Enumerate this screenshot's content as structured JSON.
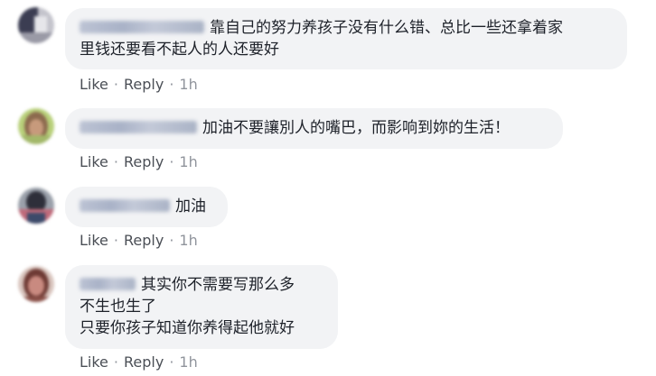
{
  "comments": [
    {
      "lines": [
        "靠自己的努力养孩子没有什么错、总比一些还拿着家",
        "里钱还要看不起人的人还要好"
      ],
      "like": "Like",
      "reply": "Reply",
      "time": "1h",
      "avatar_colors": [
        "#3b3d52",
        "#c4c4cc"
      ]
    },
    {
      "lines": [
        "加油不要讓別人的嘴巴，而影响到妳的生活！"
      ],
      "like": "Like",
      "reply": "Reply",
      "time": "1h",
      "avatar_colors": [
        "#8c6a4e",
        "#b8d07a"
      ]
    },
    {
      "lines": [
        "加油"
      ],
      "like": "Like",
      "reply": "Reply",
      "time": "1h",
      "avatar_colors": [
        "#2e2f3a",
        "#c06a7a"
      ]
    },
    {
      "lines": [
        "其实你不需要写那么多",
        "不生也生了",
        "只要你孩子知道你养得起他就好"
      ],
      "like": "Like",
      "reply": "Reply",
      "time": "1h",
      "avatar_colors": [
        "#c98a80",
        "#6e3a34"
      ]
    }
  ],
  "separator": "·"
}
